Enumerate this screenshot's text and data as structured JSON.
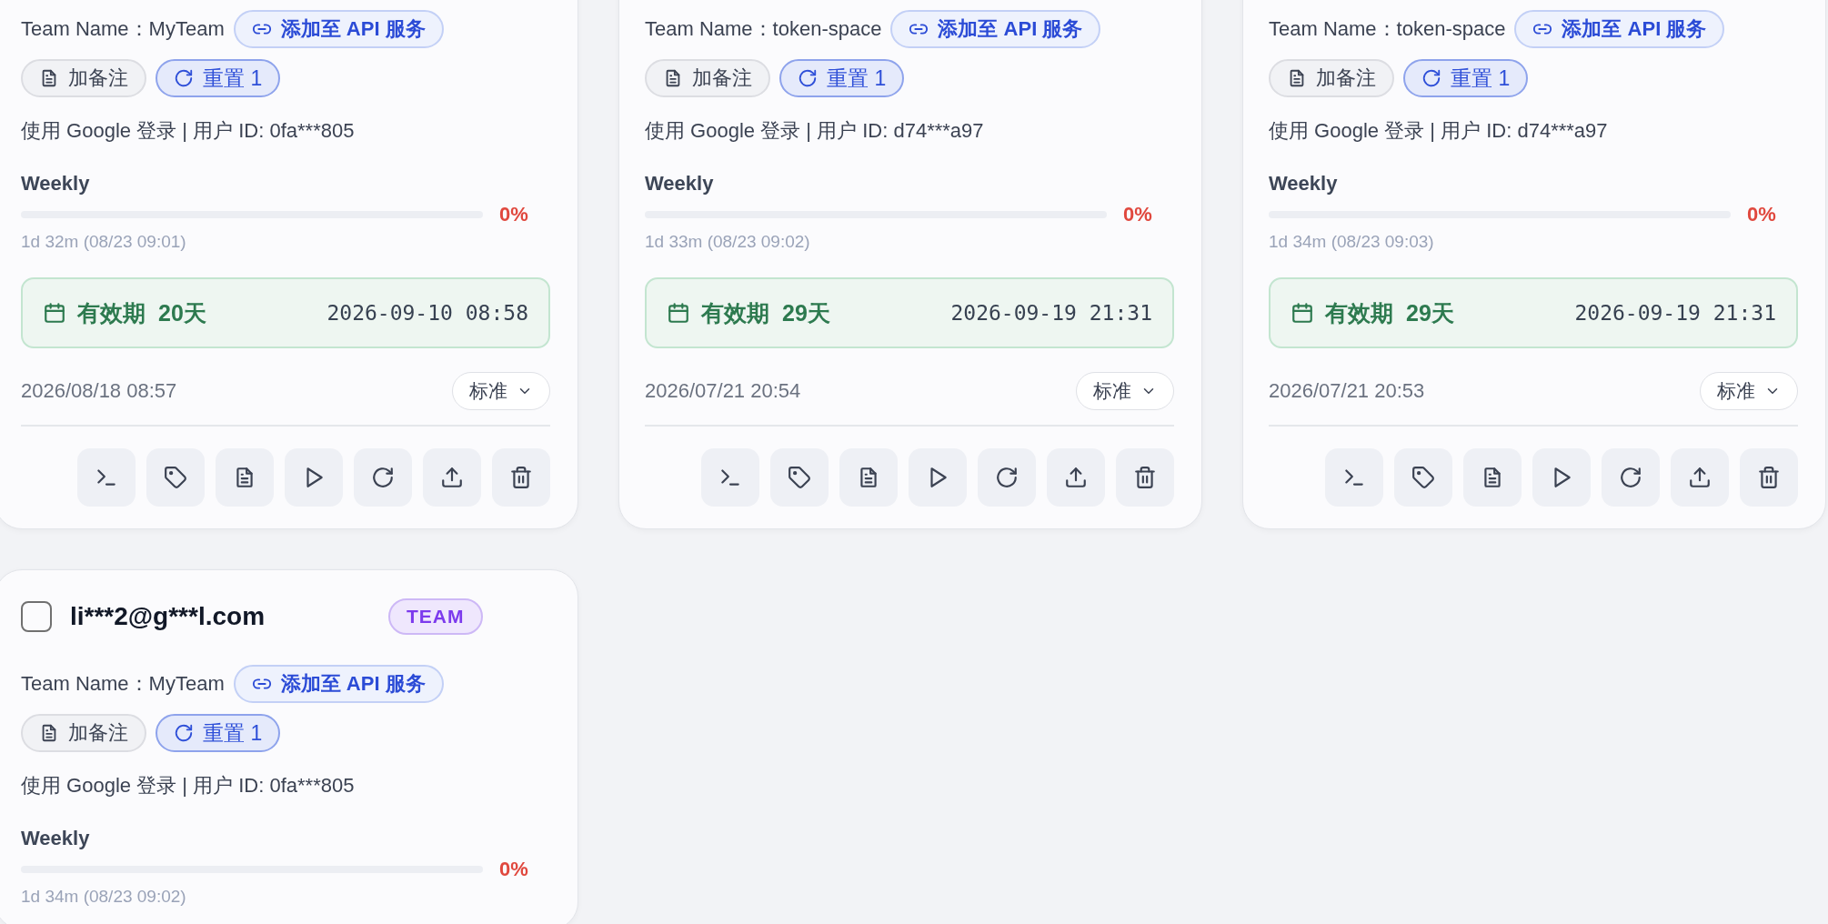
{
  "cards": [
    {
      "team": "Team Name：MyTeam",
      "api_button": "添加至 API 服务",
      "note_button": "加备注",
      "reset_button": "重置 1",
      "login_info": "使用 Google 登录 | 用户 ID: 0fa***805",
      "usage": {
        "label": "Weekly",
        "level": 0,
        "percent": "0%",
        "reset_time": "1d 32m (08/23 09:01)"
      },
      "validity": {
        "label": "有效期",
        "days": "20天",
        "expires": "2026-09-10 08:58"
      },
      "created": "2026/08/18 08:57",
      "plan_select": "标准"
    },
    {
      "team": "Team Name：token-space",
      "api_button": "添加至 API 服务",
      "note_button": "加备注",
      "reset_button": "重置 1",
      "login_info": "使用 Google 登录 | 用户 ID: d74***a97",
      "usage": {
        "label": "Weekly",
        "level": 0,
        "percent": "0%",
        "reset_time": "1d 33m (08/23 09:02)"
      },
      "validity": {
        "label": "有效期",
        "days": "29天",
        "expires": "2026-09-19 21:31"
      },
      "created": "2026/07/21 20:54",
      "plan_select": "标准"
    },
    {
      "team": "Team Name：token-space",
      "api_button": "添加至 API 服务",
      "note_button": "加备注",
      "reset_button": "重置 1",
      "login_info": "使用 Google 登录 | 用户 ID: d74***a97",
      "usage": {
        "label": "Weekly",
        "level": 0,
        "percent": "0%",
        "reset_time": "1d 34m (08/23 09:03)"
      },
      "validity": {
        "label": "有效期",
        "days": "29天",
        "expires": "2026-09-19 21:31"
      },
      "created": "2026/07/21 20:53",
      "plan_select": "标准"
    },
    {
      "header": {
        "checked": false,
        "email": "li***2@g***l.com",
        "badge": "TEAM"
      },
      "team": "Team Name：MyTeam",
      "api_button": "添加至 API 服务",
      "note_button": "加备注",
      "reset_button": "重置 1",
      "login_info": "使用 Google 登录 | 用户 ID: 0fa***805",
      "usage": {
        "label": "Weekly",
        "level": 0,
        "percent": "0%",
        "reset_time": "1d 34m (08/23 09:02)"
      }
    }
  ]
}
